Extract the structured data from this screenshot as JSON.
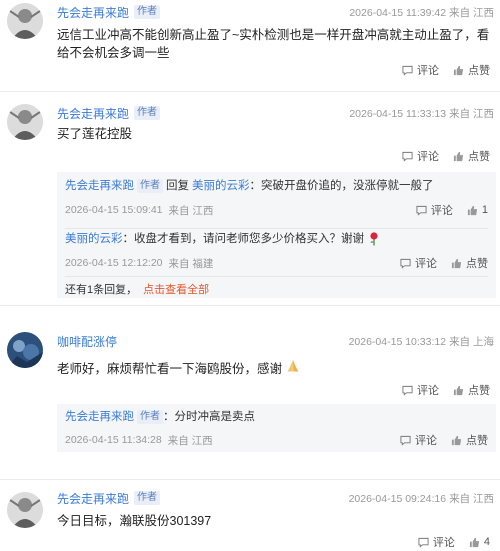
{
  "labels": {
    "comment": "评论",
    "like": "点赞",
    "reply_word": "回复"
  },
  "colors": {
    "link": "#3a7bd5",
    "more_link": "#e4572e",
    "badge_bg": "#e9eef8"
  },
  "comments": [
    {
      "user": "先会走再来跑",
      "badge": "作者",
      "time": "2026-04-15 11:39:42",
      "location": "来自 江西",
      "text": "远信工业冲高不能创新高止盈了~实朴检测也是一样开盘冲高就主动止盈了，看给不会机会多调一些",
      "like_label": "点赞"
    },
    {
      "user": "先会走再来跑",
      "badge": "作者",
      "time": "2026-04-15 11:33:13",
      "location": "来自 江西",
      "text": "买了莲花控股",
      "like_label": "点赞",
      "replies": [
        {
          "user": "先会走再来跑",
          "badge": "作者",
          "reply_to": "美丽的云彩",
          "text": "：突破开盘价追的，没涨停就一般了",
          "time": "2026-04-15 15:09:41",
          "location": "来自 江西",
          "like_label": "1"
        },
        {
          "user": "美丽的云彩",
          "text": "：收盘才看到，请问老师您多少价格买入？谢谢",
          "emoji": "rose-icon",
          "time": "2026-04-15 12:12:20",
          "location": "来自 福建",
          "like_label": "点赞"
        }
      ],
      "more": {
        "count_text": "还有1条回复，",
        "link_text": "点击查看全部"
      }
    },
    {
      "user": "咖啡配涨停",
      "time": "2026-04-15 10:33:12",
      "location": "来自 上海",
      "text": "老师好，麻烦帮忙看一下海鸥股份，感谢",
      "emoji": "pray-icon",
      "like_label": "点赞",
      "replies": [
        {
          "user": "先会走再来跑",
          "badge": "作者",
          "text": "：分时冲高是卖点",
          "time": "2026-04-15 11:34:28",
          "location": "来自 江西",
          "like_label": "点赞"
        }
      ]
    },
    {
      "user": "先会走再来跑",
      "badge": "作者",
      "time": "2026-04-15 09:24:16",
      "location": "来自 江西",
      "text": "今日目标，瀚联股份301397",
      "like_label": "4"
    }
  ]
}
